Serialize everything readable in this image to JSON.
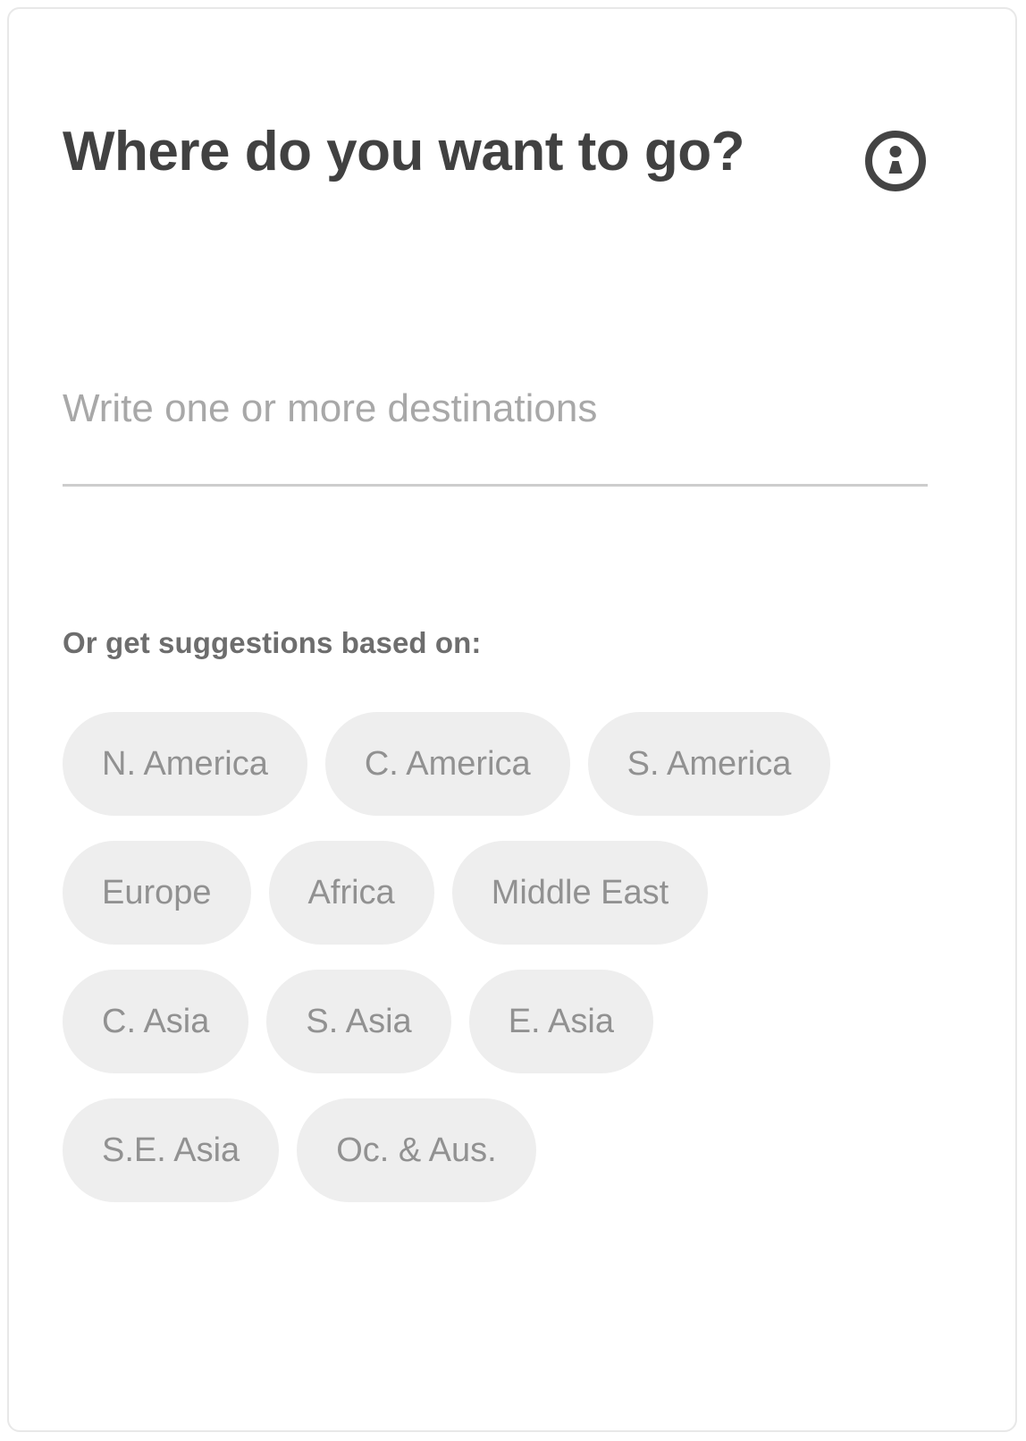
{
  "card": {
    "title": "Where do you want to go?",
    "info_icon": "info-circle-icon"
  },
  "destination": {
    "placeholder": "Write one or more destinations",
    "value": ""
  },
  "suggestions": {
    "label": "Or get suggestions based on:",
    "rows": [
      [
        "N. America",
        "C. America",
        "S. America"
      ],
      [
        "Europe",
        "Africa",
        "Middle East"
      ],
      [
        "C. Asia",
        "S. Asia",
        "E. Asia"
      ],
      [
        "S.E. Asia",
        "Oc. & Aus."
      ]
    ]
  },
  "colors": {
    "card_border": "#e8e8e8",
    "title_text": "#414141",
    "placeholder_text": "#a8a8a8",
    "input_underline": "#cdcdcd",
    "label_text": "#6d6d6d",
    "chip_background": "#eeeeee",
    "chip_text": "#919191",
    "icon": "#444444"
  }
}
